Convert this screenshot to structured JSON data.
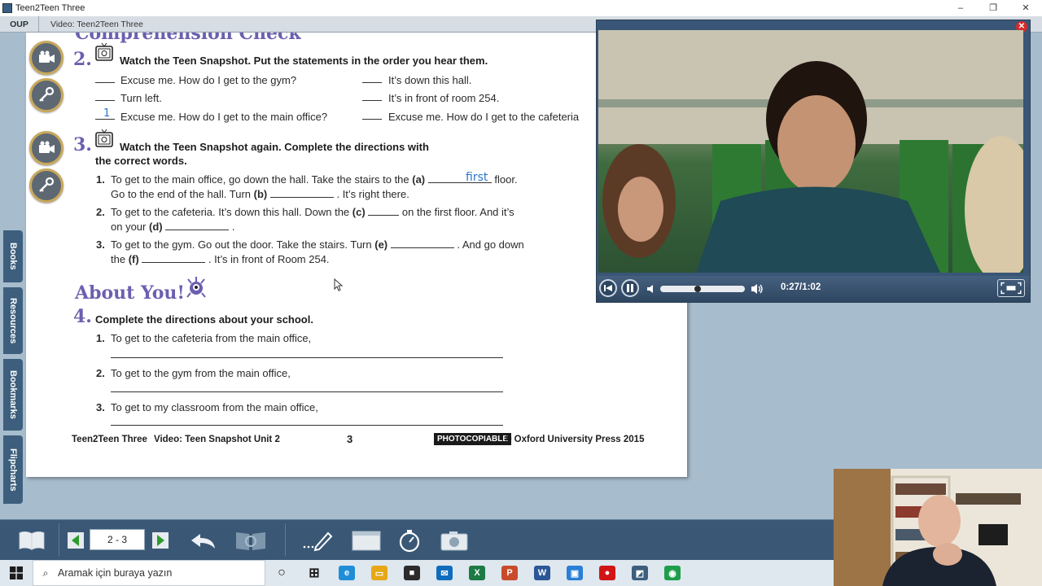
{
  "window": {
    "title": "Teen2Teen Three",
    "controls": {
      "minimize": "–",
      "restore": "❐",
      "close": "✕"
    }
  },
  "tabbar": {
    "brand": "OUP",
    "tab": "Video: Teen2Teen Three"
  },
  "sidetabs": [
    "Books",
    "Resources",
    "Bookmarks",
    "Flipcharts"
  ],
  "page": {
    "cut_heading": "Comprehension Check",
    "ex2": {
      "number": "2.",
      "instruction": "Watch the Teen Snapshot. Put the statements in the order you hear them.",
      "left": [
        {
          "blank": "",
          "text": "Excuse me. How do I get to the gym?"
        },
        {
          "blank": "",
          "text": "Turn left."
        },
        {
          "blank": "1",
          "text": "Excuse me. How do I get to the main office?"
        }
      ],
      "right": [
        {
          "blank": "",
          "text": "It’s down this hall."
        },
        {
          "blank": "",
          "text": "It’s in front of room 254."
        },
        {
          "blank": "",
          "text": "Excuse me. How do I get to the cafeteria"
        }
      ]
    },
    "ex3": {
      "number": "3.",
      "instruction_1": "Watch the Teen Snapshot again. Complete the directions with",
      "instruction_2": "the correct words.",
      "items": [
        {
          "n": "1.",
          "l1a": "To get to the main office, go down the hall. Take the stairs to the ",
          "l1b": "(a)",
          "l1c": " floor.",
          "answer_a": "first",
          "l2a": "Go to the end of the hall. Turn ",
          "l2b": "(b)",
          "l2c": " . It’s right there."
        },
        {
          "n": "2.",
          "l1a": "To get to the cafeteria. It’s down this hall. Down the ",
          "l1b": "(c)",
          "l1c": " on the first floor. And it’s",
          "l2a": "on your ",
          "l2b": "(d)",
          "l2c": " ."
        },
        {
          "n": "3.",
          "l1a": "To get to the gym. Go out the door. Take the stairs. Turn ",
          "l1b": "(e)",
          "l1c": " . And go down",
          "l2a": "the ",
          "l2b": "(f)",
          "l2c": " . It’s in front of Room 254."
        }
      ]
    },
    "about": "About You!",
    "ex4": {
      "number": "4.",
      "instruction": "Complete the directions about your school.",
      "items": [
        {
          "n": "1.",
          "text": "To get to the cafeteria from the main office,"
        },
        {
          "n": "2.",
          "text": "To get to the gym from the main office,"
        },
        {
          "n": "3.",
          "text": "To get to my classroom from the main office,"
        }
      ]
    },
    "footer": {
      "left": "Teen2Teen Three",
      "video": "Video: Teen Snapshot Unit 2",
      "page_no": "3",
      "badge": "PHOTOCOPIABLE",
      "copyright": "© Oxford University Press 2015"
    }
  },
  "video": {
    "timecode": "0:27/1:02",
    "progress_fraction": 0.435,
    "volume_fraction": 0.5
  },
  "toolbar": {
    "page_field": "2 - 3"
  },
  "taskbar": {
    "search_placeholder": "Aramak için buraya yazın",
    "apps": [
      {
        "name": "cortana-icon",
        "glyph": "○",
        "color": "#1d1d1d"
      },
      {
        "name": "task-view-icon",
        "glyph": "⊞",
        "color": "#1d1d1d"
      },
      {
        "name": "edge-icon",
        "glyph": "e",
        "color": "#1f8ed6"
      },
      {
        "name": "file-explorer-icon",
        "glyph": "▭",
        "color": "#e6a817"
      },
      {
        "name": "store-icon",
        "glyph": "■",
        "color": "#2b2b2b"
      },
      {
        "name": "mail-icon",
        "glyph": "✉",
        "color": "#0f6cbd"
      },
      {
        "name": "excel-icon",
        "glyph": "X",
        "color": "#1d7a44"
      },
      {
        "name": "powerpoint-icon",
        "glyph": "P",
        "color": "#c84b2b"
      },
      {
        "name": "word-icon",
        "glyph": "W",
        "color": "#2b5797"
      },
      {
        "name": "remote-desktop-icon",
        "glyph": "▣",
        "color": "#2a7fd6"
      },
      {
        "name": "record-icon",
        "glyph": "●",
        "color": "#d11515"
      },
      {
        "name": "teen2teen-app-icon",
        "glyph": "◩",
        "color": "#3d5f7d"
      },
      {
        "name": "camera-app-icon",
        "glyph": "◉",
        "color": "#1f9d4c"
      }
    ]
  }
}
